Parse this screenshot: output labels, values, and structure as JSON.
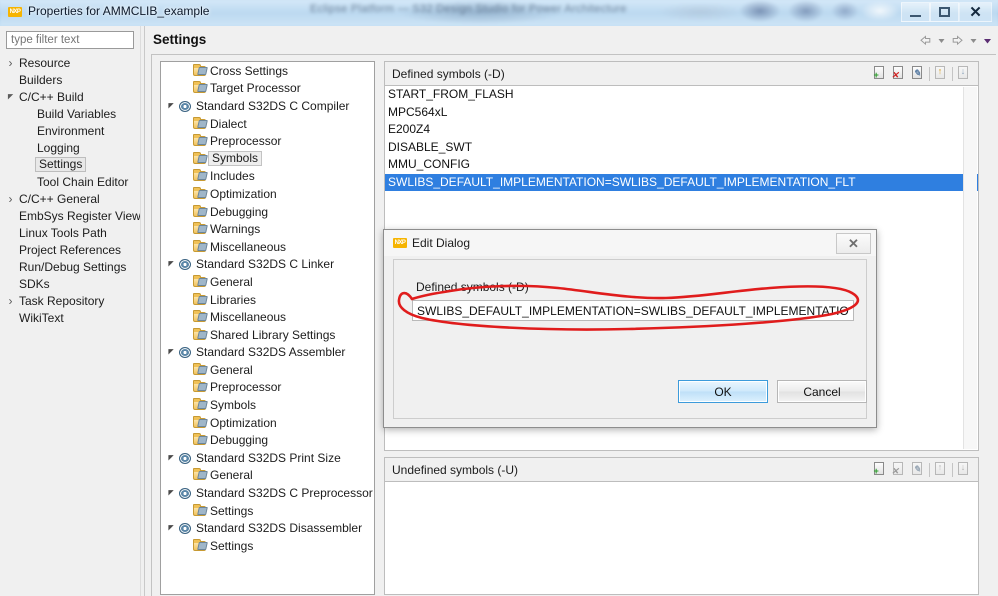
{
  "window": {
    "title": "Properties for AMMCLIB_example",
    "app_icon": "nxp-logo-icon",
    "blurred_background_text": "Eclipse Platform — S32 Design Studio for Power Architecture",
    "buttons": {
      "minimize": "minimize",
      "maximize": "maximize",
      "close": "✕"
    }
  },
  "filter": {
    "placeholder": "type filter text",
    "value": ""
  },
  "nav_tree": {
    "items": [
      {
        "label": "Resource",
        "indent": 0,
        "arrow": "collapsed",
        "selected": false
      },
      {
        "label": "Builders",
        "indent": 0,
        "arrow": "none",
        "selected": false
      },
      {
        "label": "C/C++ Build",
        "indent": 0,
        "arrow": "expanded",
        "selected": false
      },
      {
        "label": "Build Variables",
        "indent": 1,
        "arrow": "none",
        "selected": false
      },
      {
        "label": "Environment",
        "indent": 1,
        "arrow": "none",
        "selected": false
      },
      {
        "label": "Logging",
        "indent": 1,
        "arrow": "none",
        "selected": false
      },
      {
        "label": "Settings",
        "indent": 1,
        "arrow": "none",
        "selected": true
      },
      {
        "label": "Tool Chain Editor",
        "indent": 1,
        "arrow": "none",
        "selected": false
      },
      {
        "label": "C/C++ General",
        "indent": 0,
        "arrow": "collapsed",
        "selected": false
      },
      {
        "label": "EmbSys Register View",
        "indent": 0,
        "arrow": "none",
        "selected": false
      },
      {
        "label": "Linux Tools Path",
        "indent": 0,
        "arrow": "none",
        "selected": false
      },
      {
        "label": "Project References",
        "indent": 0,
        "arrow": "none",
        "selected": false
      },
      {
        "label": "Run/Debug Settings",
        "indent": 0,
        "arrow": "none",
        "selected": false
      },
      {
        "label": "SDKs",
        "indent": 0,
        "arrow": "none",
        "selected": false
      },
      {
        "label": "Task Repository",
        "indent": 0,
        "arrow": "collapsed",
        "selected": false
      },
      {
        "label": "WikiText",
        "indent": 0,
        "arrow": "none",
        "selected": false
      }
    ]
  },
  "settings": {
    "title": "Settings",
    "nav_buttons": [
      "back-arrow-icon",
      "back-dropdown-icon",
      "forward-arrow-icon",
      "forward-dropdown-icon",
      "view-menu-icon"
    ]
  },
  "tool_tree": {
    "items": [
      {
        "label": "Cross Settings",
        "indent": 1,
        "arrow": "none",
        "icon": "folder-icon",
        "selected": false
      },
      {
        "label": "Target Processor",
        "indent": 1,
        "arrow": "none",
        "icon": "folder-icon",
        "selected": false
      },
      {
        "label": "Standard S32DS C Compiler",
        "indent": 0,
        "arrow": "expanded",
        "icon": "gear-icon",
        "selected": false
      },
      {
        "label": "Dialect",
        "indent": 1,
        "arrow": "none",
        "icon": "folder-icon",
        "selected": false
      },
      {
        "label": "Preprocessor",
        "indent": 1,
        "arrow": "none",
        "icon": "folder-icon",
        "selected": false
      },
      {
        "label": "Symbols",
        "indent": 1,
        "arrow": "none",
        "icon": "folder-icon",
        "selected": true
      },
      {
        "label": "Includes",
        "indent": 1,
        "arrow": "none",
        "icon": "folder-icon",
        "selected": false
      },
      {
        "label": "Optimization",
        "indent": 1,
        "arrow": "none",
        "icon": "folder-icon",
        "selected": false
      },
      {
        "label": "Debugging",
        "indent": 1,
        "arrow": "none",
        "icon": "folder-icon",
        "selected": false
      },
      {
        "label": "Warnings",
        "indent": 1,
        "arrow": "none",
        "icon": "folder-icon",
        "selected": false
      },
      {
        "label": "Miscellaneous",
        "indent": 1,
        "arrow": "none",
        "icon": "folder-icon",
        "selected": false
      },
      {
        "label": "Standard S32DS C Linker",
        "indent": 0,
        "arrow": "expanded",
        "icon": "gear-icon",
        "selected": false
      },
      {
        "label": "General",
        "indent": 1,
        "arrow": "none",
        "icon": "folder-icon",
        "selected": false
      },
      {
        "label": "Libraries",
        "indent": 1,
        "arrow": "none",
        "icon": "folder-icon",
        "selected": false
      },
      {
        "label": "Miscellaneous",
        "indent": 1,
        "arrow": "none",
        "icon": "folder-icon",
        "selected": false
      },
      {
        "label": "Shared Library Settings",
        "indent": 1,
        "arrow": "none",
        "icon": "folder-icon",
        "selected": false
      },
      {
        "label": "Standard S32DS Assembler",
        "indent": 0,
        "arrow": "expanded",
        "icon": "gear-icon",
        "selected": false
      },
      {
        "label": "General",
        "indent": 1,
        "arrow": "none",
        "icon": "folder-icon",
        "selected": false
      },
      {
        "label": "Preprocessor",
        "indent": 1,
        "arrow": "none",
        "icon": "folder-icon",
        "selected": false
      },
      {
        "label": "Symbols",
        "indent": 1,
        "arrow": "none",
        "icon": "folder-icon",
        "selected": false
      },
      {
        "label": "Optimization",
        "indent": 1,
        "arrow": "none",
        "icon": "folder-icon",
        "selected": false
      },
      {
        "label": "Debugging",
        "indent": 1,
        "arrow": "none",
        "icon": "folder-icon",
        "selected": false
      },
      {
        "label": "Standard S32DS Print Size",
        "indent": 0,
        "arrow": "expanded",
        "icon": "gear-icon",
        "selected": false
      },
      {
        "label": "General",
        "indent": 1,
        "arrow": "none",
        "icon": "folder-icon",
        "selected": false
      },
      {
        "label": "Standard S32DS C Preprocessor",
        "indent": 0,
        "arrow": "expanded",
        "icon": "gear-icon",
        "selected": false
      },
      {
        "label": "Settings",
        "indent": 1,
        "arrow": "none",
        "icon": "folder-icon",
        "selected": false
      },
      {
        "label": "Standard S32DS Disassembler",
        "indent": 0,
        "arrow": "expanded",
        "icon": "gear-icon",
        "selected": false
      },
      {
        "label": "Settings",
        "indent": 1,
        "arrow": "none",
        "icon": "folder-icon",
        "selected": false
      }
    ]
  },
  "defined_symbols": {
    "title": "Defined symbols (-D)",
    "toolbar": [
      "add-icon",
      "delete-icon",
      "edit-icon",
      "move-up-icon",
      "move-down-icon"
    ],
    "rows": [
      {
        "text": "START_FROM_FLASH",
        "selected": false
      },
      {
        "text": "MPC564xL",
        "selected": false
      },
      {
        "text": "E200Z4",
        "selected": false
      },
      {
        "text": "DISABLE_SWT",
        "selected": false
      },
      {
        "text": "MMU_CONFIG",
        "selected": false
      },
      {
        "text": "SWLIBS_DEFAULT_IMPLEMENTATION=SWLIBS_DEFAULT_IMPLEMENTATION_FLT",
        "selected": true
      }
    ],
    "selection_color": "#2f7fe0"
  },
  "undefined_symbols": {
    "title": "Undefined symbols (-U)",
    "toolbar": [
      "add-icon",
      "delete-icon",
      "edit-icon",
      "move-up-icon",
      "move-down-icon"
    ],
    "rows": []
  },
  "edit_dialog": {
    "title": "Edit Dialog",
    "icon": "nxp-logo-icon",
    "close_label": "✕",
    "field_label": "Defined symbols (-D)",
    "field_value": "SWLIBS_DEFAULT_IMPLEMENTATION=SWLIBS_DEFAULT_IMPLEMENTATION_FLT",
    "field_placeholder": "",
    "ok_label": "OK",
    "cancel_label": "Cancel"
  },
  "annotation": {
    "type": "hand-drawn-ellipse",
    "color": "#e01c1c",
    "target": "edit-dialog-symbol-input"
  }
}
